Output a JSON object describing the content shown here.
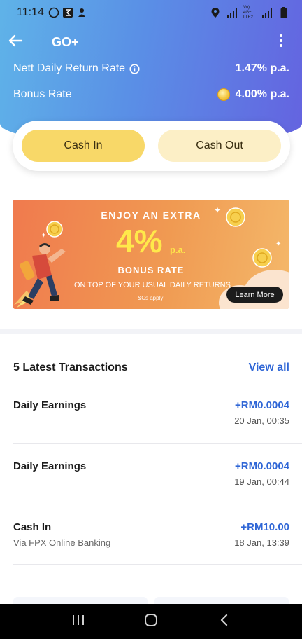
{
  "status_bar": {
    "time": "11:14",
    "network_label": "Vo) 4G+ LTE2"
  },
  "app_bar": {
    "title": "GO+"
  },
  "rates": {
    "nett_label": "Nett Daily Return Rate",
    "nett_value": "1.47% p.a.",
    "bonus_label": "Bonus Rate",
    "bonus_value": "4.00% p.a."
  },
  "actions": {
    "cash_in": "Cash In",
    "cash_out": "Cash Out"
  },
  "promo": {
    "line1": "ENJOY AN EXTRA",
    "big": "4%",
    "pa": "p.a.",
    "line2": "BONUS RATE",
    "line3": "ON TOP OF YOUR USUAL DAILY RETURNS",
    "tc": "T&Cs apply",
    "cta": "Learn More"
  },
  "transactions": {
    "title": "5 Latest Transactions",
    "view_all": "View all",
    "items": [
      {
        "name": "Daily Earnings",
        "sub": "",
        "amount": "+RM0.0004",
        "date": "20 Jan, 00:35"
      },
      {
        "name": "Daily Earnings",
        "sub": "",
        "amount": "+RM0.0004",
        "date": "19 Jan, 00:44"
      },
      {
        "name": "Cash In",
        "sub": "Via FPX Online Banking",
        "amount": "+RM10.00",
        "date": "18 Jan, 13:39"
      }
    ]
  },
  "colors": {
    "accent_blue": "#2f66d6",
    "cash_in_yellow": "#f8d868",
    "cash_out_cream": "#fcefc6",
    "header_gradient_start": "#5fb3e8",
    "header_gradient_end": "#6463e0"
  },
  "icons": {
    "back": "arrow-left-icon",
    "menu": "more-vertical-icon",
    "info": "info-circle-icon",
    "coin": "coin-icon",
    "nav_recents": "recents-icon",
    "nav_home": "home-icon",
    "nav_back": "back-chevron-icon"
  }
}
